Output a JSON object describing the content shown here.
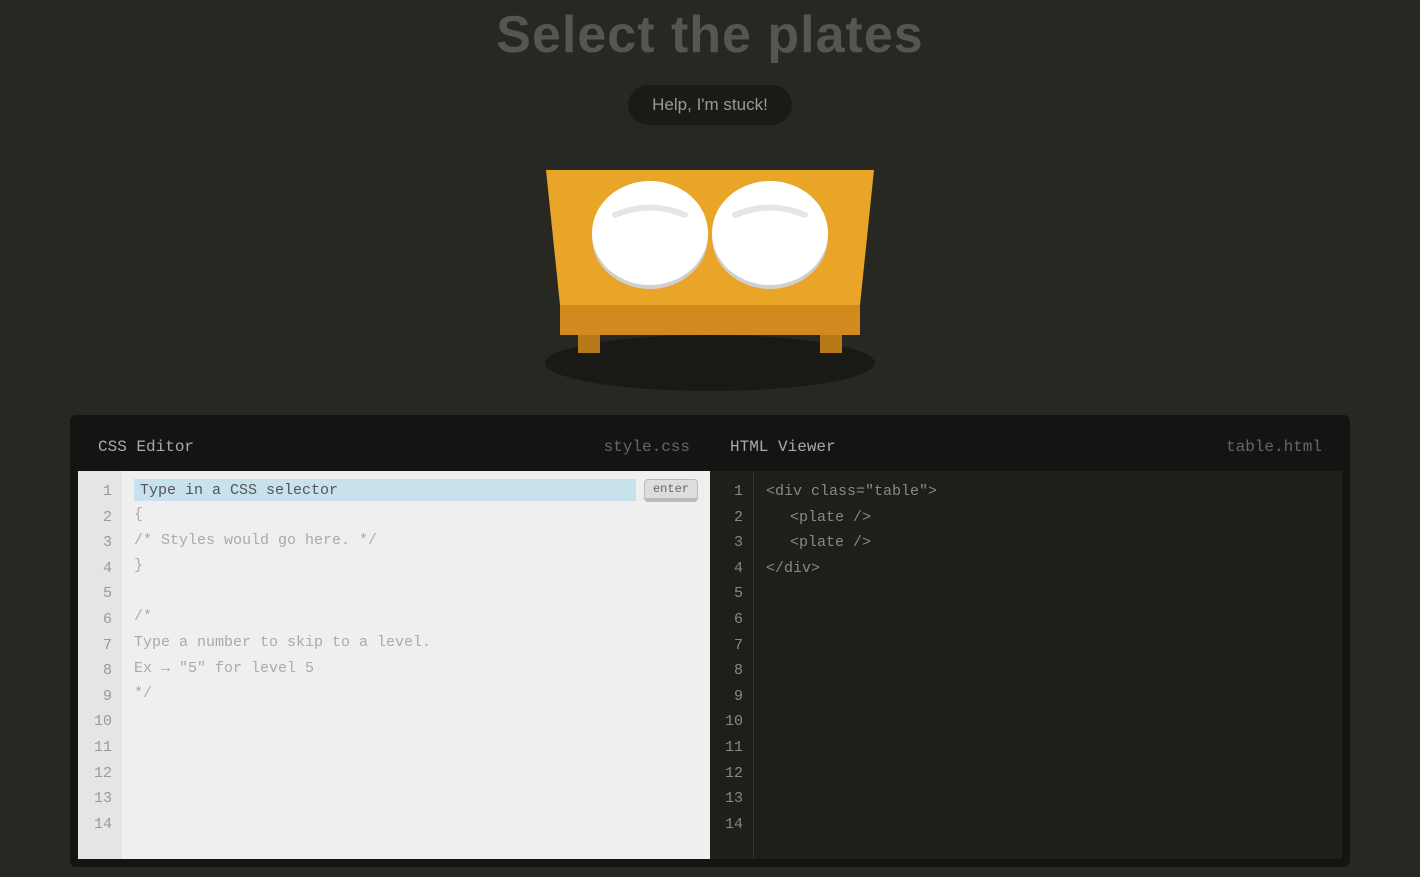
{
  "title": "Select the plates",
  "helpButton": "Help, I'm stuck!",
  "cssEditor": {
    "label": "CSS Editor",
    "filename": "style.css",
    "placeholder": "Type in a CSS selector",
    "enterButton": "enter",
    "lines": {
      "l2": "{",
      "l3": "/* Styles would go here. */",
      "l4": "}",
      "l5": "",
      "l6": "/*",
      "l7": "Type a number to skip to a level.",
      "l8": "Ex → \"5\" for level 5",
      "l9": "*/"
    },
    "lineNumbers": [
      "1",
      "2",
      "3",
      "4",
      "5",
      "6",
      "7",
      "8",
      "9",
      "10",
      "11",
      "12",
      "13",
      "14"
    ]
  },
  "htmlViewer": {
    "label": "HTML Viewer",
    "filename": "table.html",
    "lines": {
      "l1": "<div class=\"table\">",
      "l2": "<plate />",
      "l3": "<plate />",
      "l4": "</div>"
    },
    "lineNumbers": [
      "1",
      "2",
      "3",
      "4",
      "5",
      "6",
      "7",
      "8",
      "9",
      "10",
      "11",
      "12",
      "13",
      "14"
    ]
  }
}
